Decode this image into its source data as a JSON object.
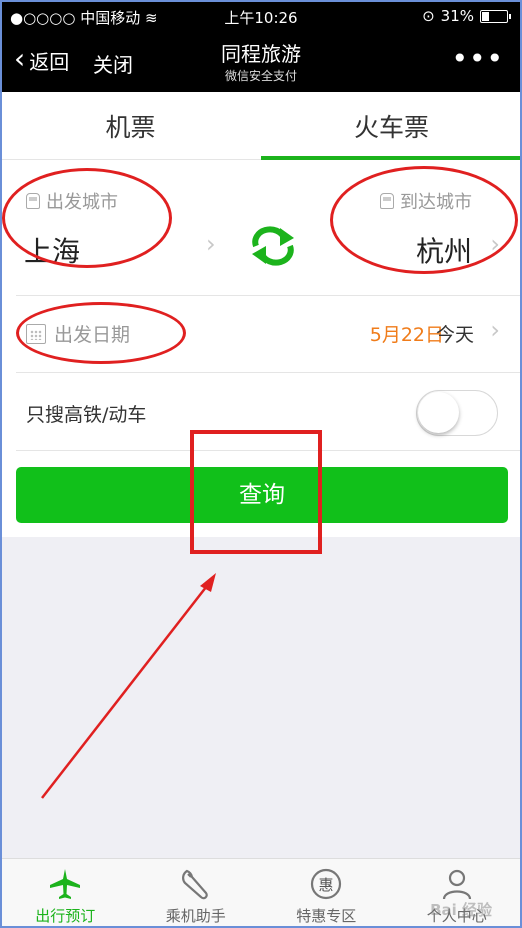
{
  "status": {
    "carrier": "●○○○○ 中国移动",
    "time": "上午10:26",
    "battery": "31%",
    "battery_level": 0.31
  },
  "nav": {
    "back": "返回",
    "close": "关闭",
    "title": "同程旅游",
    "subtitle": "微信安全支付",
    "more": "•••"
  },
  "tabs": [
    {
      "label": "机票",
      "active": false
    },
    {
      "label": "火车票",
      "active": true
    }
  ],
  "route": {
    "from_label": "出发城市",
    "from_city": "上海",
    "to_label": "到达城市",
    "to_city": "杭州"
  },
  "date": {
    "label": "出发日期",
    "value": "5月22日",
    "relative": "今天"
  },
  "filter": {
    "label": "只搜高铁/动车",
    "enabled": false
  },
  "query_button": "查询",
  "bottom_nav": [
    {
      "label": "出行预订",
      "icon": "plane-icon",
      "active": true
    },
    {
      "label": "乘机助手",
      "icon": "wrench-icon",
      "active": false
    },
    {
      "label": "特惠专区",
      "icon": "discount-icon",
      "active": false
    },
    {
      "label": "个人中心",
      "icon": "user-icon",
      "active": false
    }
  ],
  "colors": {
    "accent": "#1cb31c",
    "button": "#11c01a",
    "date": "#f07c1a",
    "annotation": "#e02020"
  },
  "watermark": "Bai 经验"
}
